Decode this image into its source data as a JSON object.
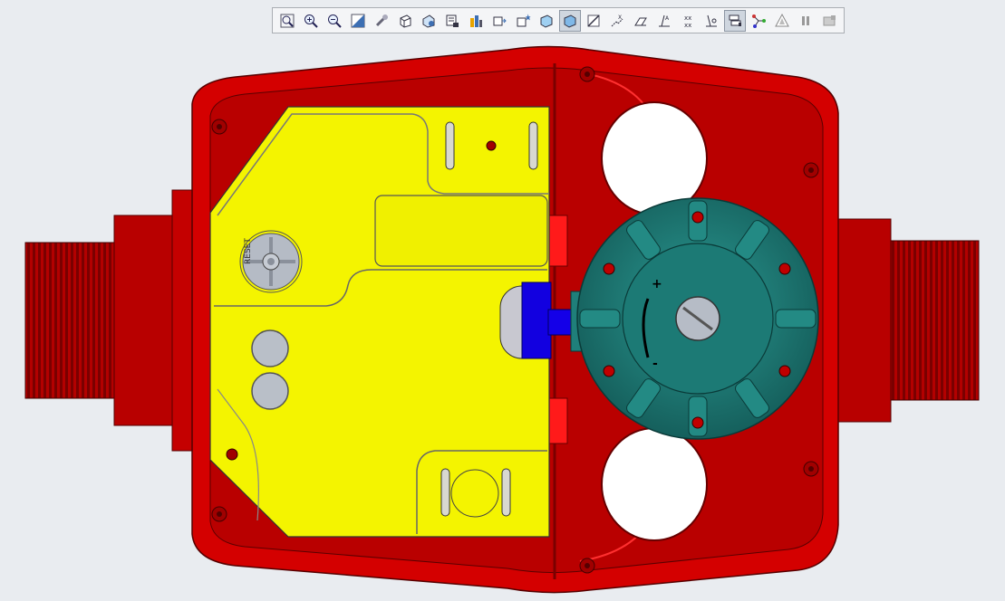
{
  "app": {
    "window": "CAD 3D viewport"
  },
  "toolbar": {
    "items": [
      {
        "name": "zoom-fit",
        "icon": "zoom-fit-icon"
      },
      {
        "name": "zoom-in",
        "icon": "zoom-in-icon"
      },
      {
        "name": "zoom-out",
        "icon": "zoom-out-icon"
      },
      {
        "name": "zoom-window",
        "icon": "zoom-window-icon"
      },
      {
        "name": "pan",
        "icon": "pan-icon"
      },
      {
        "name": "view-cube",
        "icon": "view-cube-icon"
      },
      {
        "name": "standard-views",
        "icon": "standard-views-icon"
      },
      {
        "name": "saved-views",
        "icon": "saved-views-icon"
      },
      {
        "name": "appearance",
        "icon": "appearance-icon"
      },
      {
        "name": "display-style",
        "icon": "display-style-icon"
      },
      {
        "name": "section",
        "icon": "section-icon"
      },
      {
        "name": "perspective",
        "icon": "perspective-icon"
      },
      {
        "name": "shading",
        "icon": "shading-icon",
        "active": true
      },
      {
        "name": "datum-planes",
        "icon": "datum-planes-icon"
      },
      {
        "name": "datum-axes",
        "icon": "datum-axes-icon"
      },
      {
        "name": "datum-points",
        "icon": "datum-points-icon"
      },
      {
        "name": "coordinate-systems",
        "icon": "coordinate-systems-icon"
      },
      {
        "name": "annotations",
        "icon": "annotations-icon"
      },
      {
        "name": "spin-center",
        "icon": "spin-center-icon"
      },
      {
        "name": "model-tree-filter",
        "icon": "model-tree-filter-icon",
        "active": true
      },
      {
        "name": "connections",
        "icon": "connections-icon"
      },
      {
        "name": "warnings",
        "icon": "warnings-icon"
      },
      {
        "name": "pause",
        "icon": "pause-icon"
      },
      {
        "name": "regenerate",
        "icon": "regenerate-icon"
      }
    ]
  },
  "model": {
    "housing_color": "#d40000",
    "cover_color": "#f4f400",
    "gauge_color": "#1f7f7a",
    "button_label": "RESET",
    "gauge_plus": "+",
    "gauge_minus": "-"
  }
}
